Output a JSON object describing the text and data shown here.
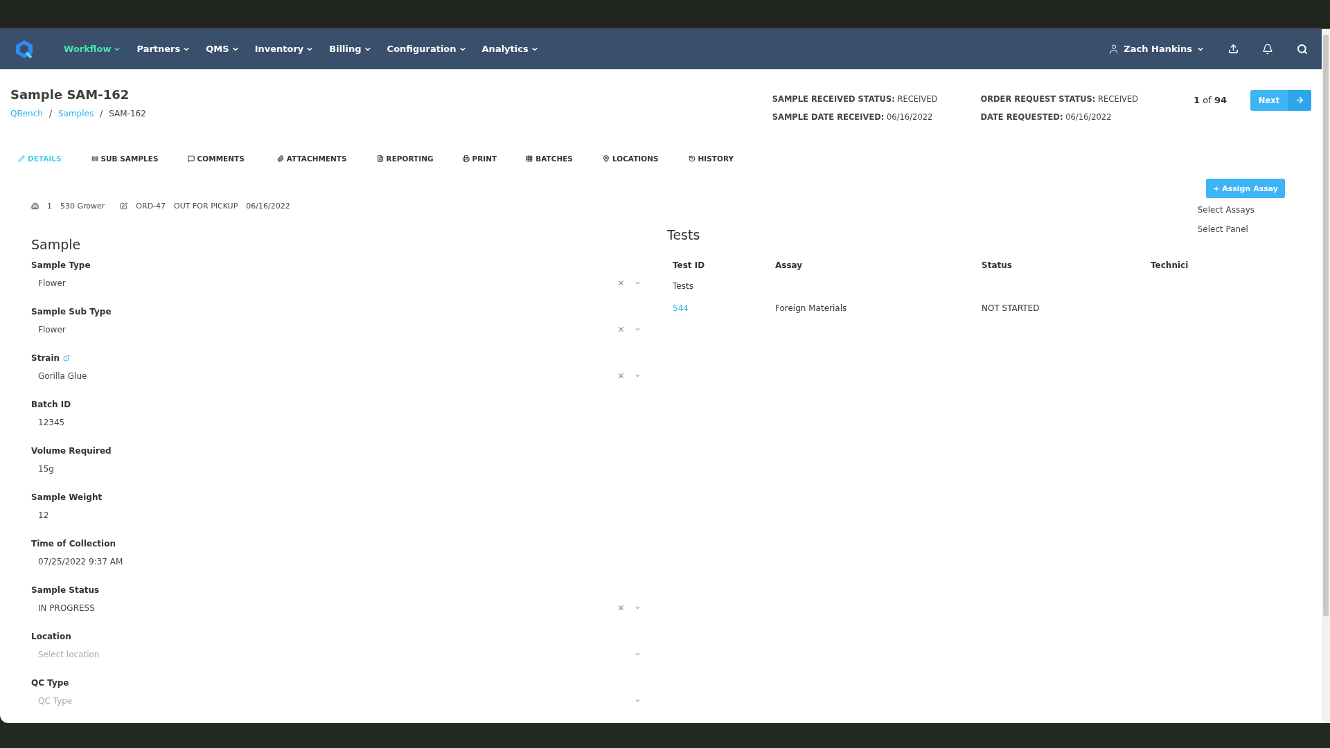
{
  "nav": {
    "items": [
      {
        "label": "Workflow",
        "selected": true
      },
      {
        "label": "Partners",
        "selected": false
      },
      {
        "label": "QMS",
        "selected": false
      },
      {
        "label": "Inventory",
        "selected": false
      },
      {
        "label": "Billing",
        "selected": false
      },
      {
        "label": "Configuration",
        "selected": false
      },
      {
        "label": "Analytics",
        "selected": false
      }
    ],
    "user": "Zach Hankins"
  },
  "header": {
    "title": "Sample SAM-162",
    "breadcrumb": [
      "QBench",
      "Samples",
      "SAM-162"
    ],
    "separator": "/",
    "statuses": [
      [
        {
          "label": "SAMPLE RECEIVED STATUS:",
          "value": "RECEIVED"
        },
        {
          "label": "SAMPLE DATE RECEIVED:",
          "value": "06/16/2022"
        }
      ],
      [
        {
          "label": "ORDER REQUEST STATUS:",
          "value": "RECEIVED"
        },
        {
          "label": "DATE REQUESTED:",
          "value": "06/16/2022"
        }
      ]
    ],
    "pager": {
      "current": "1",
      "of": "of",
      "total": "94"
    },
    "next_button": "Next"
  },
  "tabs": [
    {
      "label": "DETAILS",
      "selected": true
    },
    {
      "label": "SUB SAMPLES",
      "selected": false
    },
    {
      "label": "COMMENTS",
      "selected": false
    },
    {
      "label": "ATTACHMENTS",
      "selected": false
    },
    {
      "label": "REPORTING",
      "selected": false
    },
    {
      "label": "PRINT",
      "selected": false
    },
    {
      "label": "BATCHES",
      "selected": false
    },
    {
      "label": "LOCATIONS",
      "selected": false
    },
    {
      "label": "HISTORY",
      "selected": false
    }
  ],
  "info": {
    "count": "1",
    "customer": "530 Grower",
    "order": "ORD-47",
    "order_status": "OUT FOR PICKUP",
    "date": "06/16/2022"
  },
  "assign_button": "+ Assign Assay",
  "assign_menu": [
    "Select Assays",
    "Select Panel"
  ],
  "sample": {
    "title": "Sample",
    "fields": [
      {
        "kind": "select",
        "label": "Sample Type",
        "value": "Flower"
      },
      {
        "kind": "select",
        "label": "Sample Sub Type",
        "value": "Flower"
      },
      {
        "kind": "select",
        "label": "Strain",
        "value": "Gorilla Glue",
        "link": true
      },
      {
        "kind": "text",
        "label": "Batch ID",
        "value": "12345"
      },
      {
        "kind": "text",
        "label": "Volume Required",
        "value": "15g"
      },
      {
        "kind": "text",
        "label": "Sample Weight",
        "value": "12"
      },
      {
        "kind": "text",
        "label": "Time of Collection",
        "value": "07/25/2022 9:37 AM"
      },
      {
        "kind": "select",
        "label": "Sample Status",
        "value": "IN PROGRESS"
      },
      {
        "kind": "select",
        "label": "Location",
        "placeholder": "Select location"
      },
      {
        "kind": "select",
        "label": "QC Type",
        "placeholder": "QC Type"
      }
    ]
  },
  "tests": {
    "title": "Tests",
    "columns": [
      "Test ID",
      "Assay",
      "Status",
      "Technici"
    ],
    "group": "Tests",
    "rows": [
      {
        "test_id": "544",
        "assay": "Foreign Materials",
        "status": "NOT STARTED"
      }
    ]
  }
}
